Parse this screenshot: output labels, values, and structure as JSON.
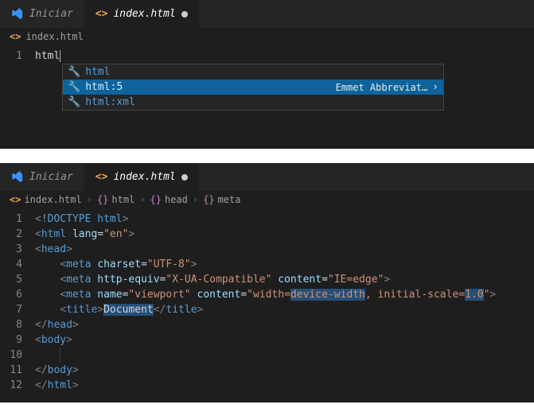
{
  "panel1": {
    "tabs": {
      "iniciar": "Iniciar",
      "file": "index.html"
    },
    "breadcrumbs": [
      "index.html"
    ],
    "line_number": "1",
    "typed": "html",
    "autocomplete": {
      "items": [
        {
          "label": "html",
          "desc": "",
          "selected": false
        },
        {
          "label": "html:5",
          "desc": "Emmet Abbreviat…",
          "selected": true
        },
        {
          "label": "html:xml",
          "desc": "",
          "selected": false
        }
      ]
    }
  },
  "panel2": {
    "tabs": {
      "iniciar": "Iniciar",
      "file": "index.html"
    },
    "breadcrumbs": [
      "index.html",
      "html",
      "head",
      "meta"
    ],
    "line_numbers": [
      "1",
      "2",
      "3",
      "4",
      "5",
      "6",
      "7",
      "8",
      "9",
      "10",
      "11",
      "12"
    ],
    "code": {
      "l1": {
        "doctype": "!DOCTYPE",
        "html": "html"
      },
      "l2": {
        "tag": "html",
        "attr": "lang",
        "val": "\"en\""
      },
      "l3": {
        "tag": "head"
      },
      "l4": {
        "tag": "meta",
        "attr": "charset",
        "val": "\"UTF-8\""
      },
      "l5": {
        "tag": "meta",
        "a1": "http-equiv",
        "v1": "\"X-UA-Compatible\"",
        "a2": "content",
        "v2": "\"IE=edge\""
      },
      "l6": {
        "tag": "meta",
        "a1": "name",
        "v1": "\"viewport\"",
        "a2": "content",
        "v2a": "\"width=",
        "sel1": "device-width",
        "mid": ", initial-scale=",
        "sel2": "1.0",
        "end": "\""
      },
      "l7": {
        "tag": "title",
        "text": "Document"
      },
      "l8": {
        "tag": "head"
      },
      "l9": {
        "tag": "body"
      },
      "l11": {
        "tag": "body"
      },
      "l12": {
        "tag": "html"
      }
    }
  }
}
